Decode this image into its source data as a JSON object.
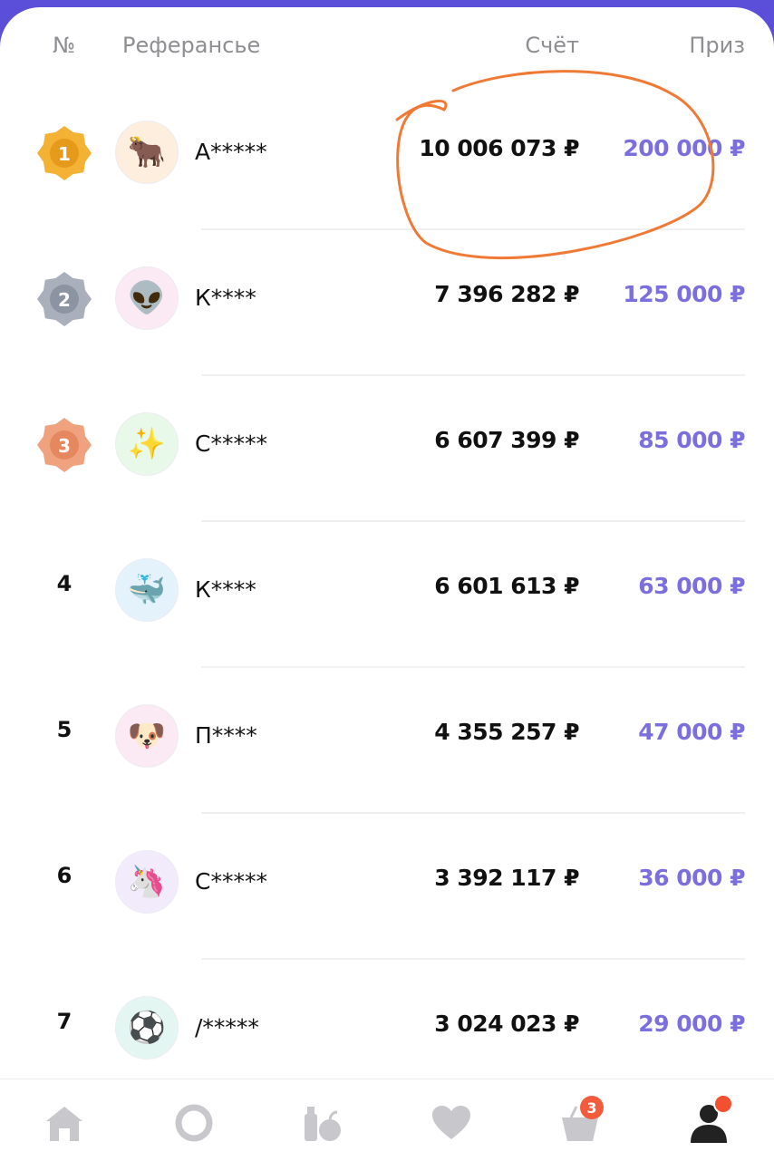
{
  "header": {
    "no": "№",
    "referral": "Реферансье",
    "score": "Счёт",
    "prize": "Приз"
  },
  "rows": [
    {
      "rank": "1",
      "medal": "gold",
      "avatar": "🐂",
      "avatar_bg": "#fdeedd",
      "name": "А*****",
      "score": "10 006 073 ₽",
      "prize": "200 000 ₽"
    },
    {
      "rank": "2",
      "medal": "silver",
      "avatar": "👽",
      "avatar_bg": "#fbe9f3",
      "name": "К****",
      "score": "7 396 282 ₽",
      "prize": "125 000 ₽"
    },
    {
      "rank": "3",
      "medal": "bronze",
      "avatar": "✨",
      "avatar_bg": "#e8f8e9",
      "name": "С*****",
      "score": "6 607 399 ₽",
      "prize": "85 000 ₽"
    },
    {
      "rank": "4",
      "medal": "",
      "avatar": "🐳",
      "avatar_bg": "#e3f2fb",
      "name": "К****",
      "score": "6 601 613 ₽",
      "prize": "63 000 ₽"
    },
    {
      "rank": "5",
      "medal": "",
      "avatar": "🐶",
      "avatar_bg": "#fbe9f3",
      "name": "П****",
      "score": "4 355 257 ₽",
      "prize": "47 000 ₽"
    },
    {
      "rank": "6",
      "medal": "",
      "avatar": "🦄",
      "avatar_bg": "#f1ebfb",
      "name": "С*****",
      "score": "3 392 117 ₽",
      "prize": "36 000 ₽"
    },
    {
      "rank": "7",
      "medal": "",
      "avatar": "⚽",
      "avatar_bg": "#e3f6f1",
      "name": "/*****",
      "score": "3 024 023 ₽",
      "prize": "29 000 ₽"
    }
  ],
  "tabbar": {
    "items": [
      "home-icon",
      "alice-icon",
      "grocery-icon",
      "favorites-icon",
      "basket-icon",
      "profile-icon"
    ],
    "basket_badge": "3"
  },
  "colors": {
    "accent": "#7b6fe0",
    "brand": "#5b4fd9",
    "annotation": "#f07a35"
  }
}
